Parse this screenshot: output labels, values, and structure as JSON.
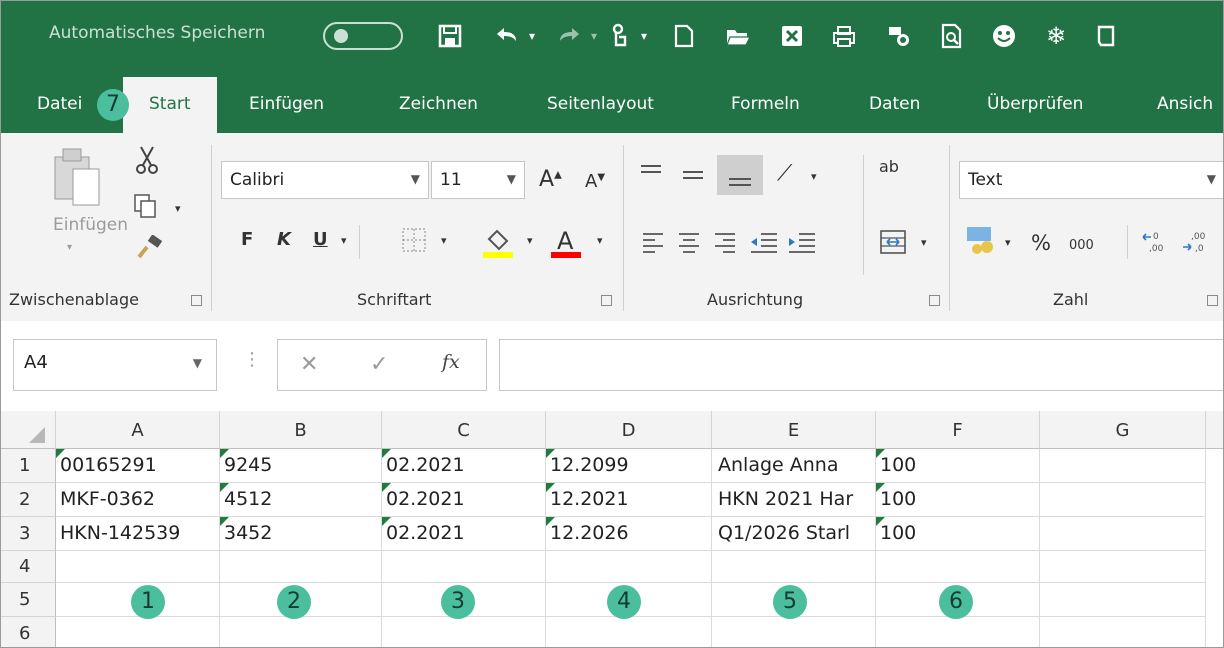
{
  "title_bar": {
    "autosave_label": "Automatisches Speichern",
    "autosave_toggle_state": "Aus",
    "quick_access_icons": [
      "save-icon",
      "undo-icon",
      "redo-icon",
      "touch-mode-icon",
      "new-file-icon",
      "open-folder-icon",
      "excel-icon",
      "print-icon",
      "share-icon",
      "print-preview-icon",
      "smiley-icon",
      "snowflake-icon",
      "customize-icon"
    ]
  },
  "tabs": [
    {
      "label": "Datei"
    },
    {
      "label": "Start"
    },
    {
      "label": "Einfügen"
    },
    {
      "label": "Zeichnen"
    },
    {
      "label": "Seitenlayout"
    },
    {
      "label": "Formeln"
    },
    {
      "label": "Daten"
    },
    {
      "label": "Überprüfen"
    },
    {
      "label": "Ansich"
    }
  ],
  "active_tab": "Start",
  "ribbon": {
    "clipboard": {
      "paste_label": "Einfügen",
      "group_label": "Zwischenablage"
    },
    "font": {
      "family": "Calibri",
      "size": "11",
      "bold": "F",
      "italic": "K",
      "underline": "U",
      "group_label": "Schriftart",
      "fill_color": "#ffff00",
      "font_color": "#ff0000"
    },
    "alignment": {
      "group_label": "Ausrichtung",
      "wrap_label": "ab"
    },
    "number": {
      "format": "Text",
      "percent": "%",
      "thousands": "000",
      "group_label": "Zahl"
    }
  },
  "formula_bar": {
    "name_box": "A4",
    "fx": "fx",
    "formula": ""
  },
  "grid": {
    "columns": [
      "A",
      "B",
      "C",
      "D",
      "E",
      "F",
      "G"
    ],
    "rows": [
      {
        "num": "1",
        "cells": [
          "00165291",
          "9245",
          "02.2021",
          "12.2099",
          "Anlage Anna",
          "100",
          ""
        ]
      },
      {
        "num": "2",
        "cells": [
          "MKF-0362",
          "4512",
          "02.2021",
          "12.2021",
          "HKN 2021 Har",
          "100",
          ""
        ]
      },
      {
        "num": "3",
        "cells": [
          "HKN-142539",
          "3452",
          "02.2021",
          "12.2026",
          "Q1/2026 Starl",
          "100",
          ""
        ]
      },
      {
        "num": "4",
        "cells": [
          "",
          "",
          "",
          "",
          "",
          "",
          ""
        ]
      },
      {
        "num": "5",
        "cells": [
          "",
          "",
          "",
          "",
          "",
          "",
          ""
        ]
      },
      {
        "num": "6",
        "cells": [
          "",
          "",
          "",
          "",
          "",
          "",
          ""
        ]
      }
    ]
  },
  "callouts": {
    "tab": "7",
    "col_a": "1",
    "col_b": "2",
    "col_c": "3",
    "col_d": "4",
    "col_e": "5",
    "col_f": "6"
  },
  "colors": {
    "excel_green": "#217346",
    "callout": "#4bbf9d",
    "error_triangle": "#1e7d3e"
  }
}
